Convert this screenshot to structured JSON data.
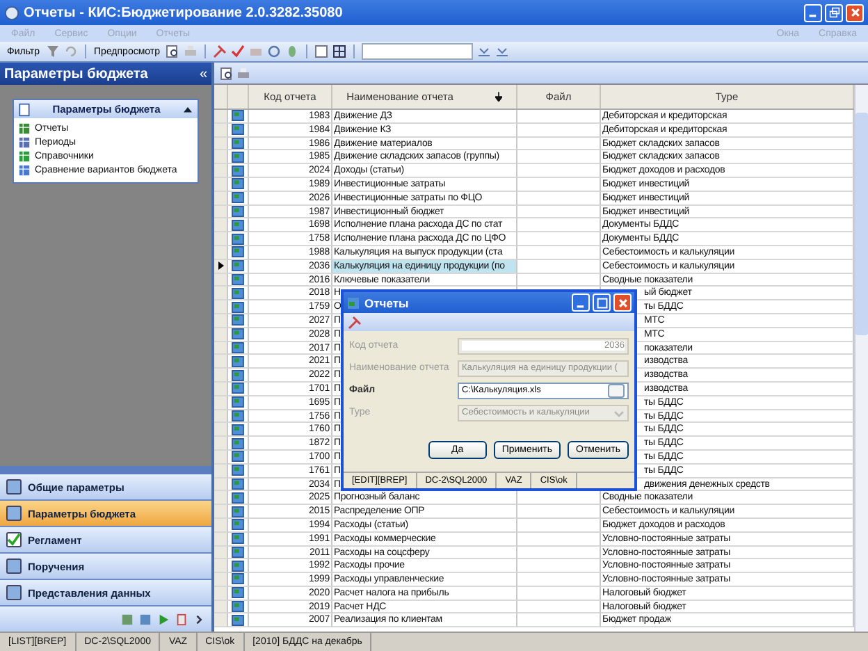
{
  "window": {
    "title": "Отчеты - КИС:Бюджетирование  2.0.3282.35080"
  },
  "menu_left": [
    {
      "label": "Файл",
      "disabled": true
    },
    {
      "label": "Сервис",
      "disabled": true
    },
    {
      "label": "Опции",
      "disabled": true
    },
    {
      "label": "Отчеты",
      "disabled": true
    }
  ],
  "menu_right": [
    {
      "label": "Окна",
      "disabled": true
    },
    {
      "label": "Справка",
      "disabled": true
    }
  ],
  "toolbar": {
    "filter": "Фильтр",
    "preview": "Предпросмотр"
  },
  "sidebar": {
    "title": "Параметры бюджета",
    "collapse": "«",
    "group": {
      "title": "Параметры бюджета",
      "expanded": true,
      "items": [
        {
          "label": "Отчеты",
          "kind": "reports"
        },
        {
          "label": "Периоды",
          "kind": "periods"
        },
        {
          "label": "Справочники",
          "kind": "books"
        },
        {
          "label": "Сравнение вариантов бюджета",
          "kind": "compare"
        }
      ]
    },
    "nav": [
      {
        "label": "Общие параметры",
        "selected": false
      },
      {
        "label": "Параметры бюджета",
        "selected": true
      },
      {
        "label": "Регламент",
        "selected": false
      },
      {
        "label": "Поручения",
        "selected": false
      },
      {
        "label": "Представления данных",
        "selected": false
      }
    ]
  },
  "table": {
    "columns": [
      "Код отчета",
      "Наименование отчета",
      "Файл",
      "Type"
    ],
    "rows": [
      {
        "code": "1983",
        "name": "Движение ДЗ",
        "type": "Дебиторская и кредиторская",
        "selected": false
      },
      {
        "code": "1984",
        "name": "Движение КЗ",
        "type": "Дебиторская и кредиторская",
        "selected": false
      },
      {
        "code": "1986",
        "name": "Движение материалов",
        "type": "Бюджет складских запасов",
        "selected": false
      },
      {
        "code": "1985",
        "name": "Движение складских запасов (группы)",
        "type": "Бюджет складских запасов",
        "selected": false
      },
      {
        "code": "2024",
        "name": "Доходы (статьи)",
        "type": "Бюджет доходов и расходов",
        "selected": false
      },
      {
        "code": "1989",
        "name": "Инвестиционные затраты",
        "type": "Бюджет инвестиций",
        "selected": false
      },
      {
        "code": "2026",
        "name": "Инвестиционные затраты по ФЦО",
        "type": "Бюджет инвестиций",
        "selected": false
      },
      {
        "code": "1987",
        "name": "Инвестиционный бюджет",
        "type": "Бюджет инвестиций",
        "selected": false
      },
      {
        "code": "1698",
        "name": "Исполнение плана расхода ДС по стат",
        "type": "Документы БДДС",
        "selected": false
      },
      {
        "code": "1758",
        "name": "Исполнение плана расхода ДС по ЦФО",
        "type": "Документы БДДС",
        "selected": false
      },
      {
        "code": "1988",
        "name": "Калькуляция на выпуск продукции (ста",
        "type": "Себестоимость и калькуляции",
        "selected": false
      },
      {
        "code": "2036",
        "name": "Калькуляция на единицу продукции (по",
        "type": "Себестоимость и калькуляции",
        "selected": true
      },
      {
        "code": "2016",
        "name": "Ключевые показатели",
        "type": "Сводные показатели",
        "selected": false
      },
      {
        "code": "2018",
        "name": "Н",
        "type_tail": "ый бюджет",
        "selected": false
      },
      {
        "code": "1759",
        "name": "О",
        "type_tail": "ты БДДС",
        "selected": false
      },
      {
        "code": "2027",
        "name": "П",
        "type_tail": "МТС",
        "selected": false
      },
      {
        "code": "2028",
        "name": "П",
        "type_tail": "МТС",
        "selected": false
      },
      {
        "code": "2017",
        "name": "П",
        "type_tail": "показатели",
        "selected": false
      },
      {
        "code": "2021",
        "name": "П",
        "type_tail": "изводства",
        "selected": false
      },
      {
        "code": "2022",
        "name": "П",
        "type_tail": "изводства",
        "selected": false
      },
      {
        "code": "1701",
        "name": "П",
        "type_tail": "изводства",
        "selected": false
      },
      {
        "code": "1695",
        "name": "П",
        "type_tail": "ты БДДС",
        "selected": false
      },
      {
        "code": "1756",
        "name": "П",
        "type_tail": "ты БДДС",
        "selected": false
      },
      {
        "code": "1760",
        "name": "П",
        "type_tail": "ты БДДС",
        "selected": false
      },
      {
        "code": "1872",
        "name": "П",
        "type_tail": "ты БДДС",
        "selected": false
      },
      {
        "code": "1700",
        "name": "П",
        "type_tail": "ты БДДС",
        "selected": false
      },
      {
        "code": "1761",
        "name": "П",
        "type_tail": "ты БДДС",
        "selected": false
      },
      {
        "code": "2034",
        "name": "П",
        "type_tail": "движения денежных средств",
        "selected": false
      },
      {
        "code": "2025",
        "name": "Прогнозный баланс",
        "type": "Сводные показатели",
        "selected": false
      },
      {
        "code": "2015",
        "name": "Распределение ОПР",
        "type": "Себестоимость и калькуляции",
        "selected": false
      },
      {
        "code": "1994",
        "name": "Расходы (статьи)",
        "type": "Бюджет доходов и расходов",
        "selected": false
      },
      {
        "code": "1991",
        "name": "Расходы коммерческие",
        "type": "Условно-постоянные затраты",
        "selected": false
      },
      {
        "code": "2011",
        "name": "Расходы на соцсферу",
        "type": "Условно-постоянные затраты",
        "selected": false
      },
      {
        "code": "1992",
        "name": "Расходы прочие",
        "type": "Условно-постоянные затраты",
        "selected": false
      },
      {
        "code": "1999",
        "name": "Расходы управленческие",
        "type": "Условно-постоянные затраты",
        "selected": false
      },
      {
        "code": "2020",
        "name": "Расчет налога на прибыль",
        "type": "Налоговый бюджет",
        "selected": false
      },
      {
        "code": "2019",
        "name": "Расчет НДС",
        "type": "Налоговый бюджет",
        "selected": false
      },
      {
        "code": "2007",
        "name": "Реализация по клиентам",
        "type": "Бюджет продаж",
        "selected": false
      }
    ]
  },
  "dialog": {
    "title": "Отчеты",
    "fields": [
      {
        "label": "Код отчета",
        "value": "2036",
        "kind": "number",
        "disabled": true
      },
      {
        "label": "Наименование отчета",
        "value": "Калькуляция на единицу продукции (",
        "kind": "text",
        "disabled": true
      },
      {
        "label": "Файл",
        "value": "C:\\Калькуляция.xls",
        "kind": "file",
        "disabled": false
      },
      {
        "label": "Type",
        "value": "Себестоимость и калькуляции",
        "kind": "select",
        "disabled": true
      }
    ],
    "buttons": [
      "Да",
      "Применить",
      "Отменить"
    ],
    "status_bar": [
      "[EDIT][BREP]",
      "DC-2\\SQL2000",
      "VAZ",
      "CIS\\ok"
    ]
  },
  "status_bar": [
    "[LIST][BREP]",
    "DC-2\\SQL2000",
    "VAZ",
    "CIS\\ok",
    "[2010] БДДС на декабрь"
  ]
}
